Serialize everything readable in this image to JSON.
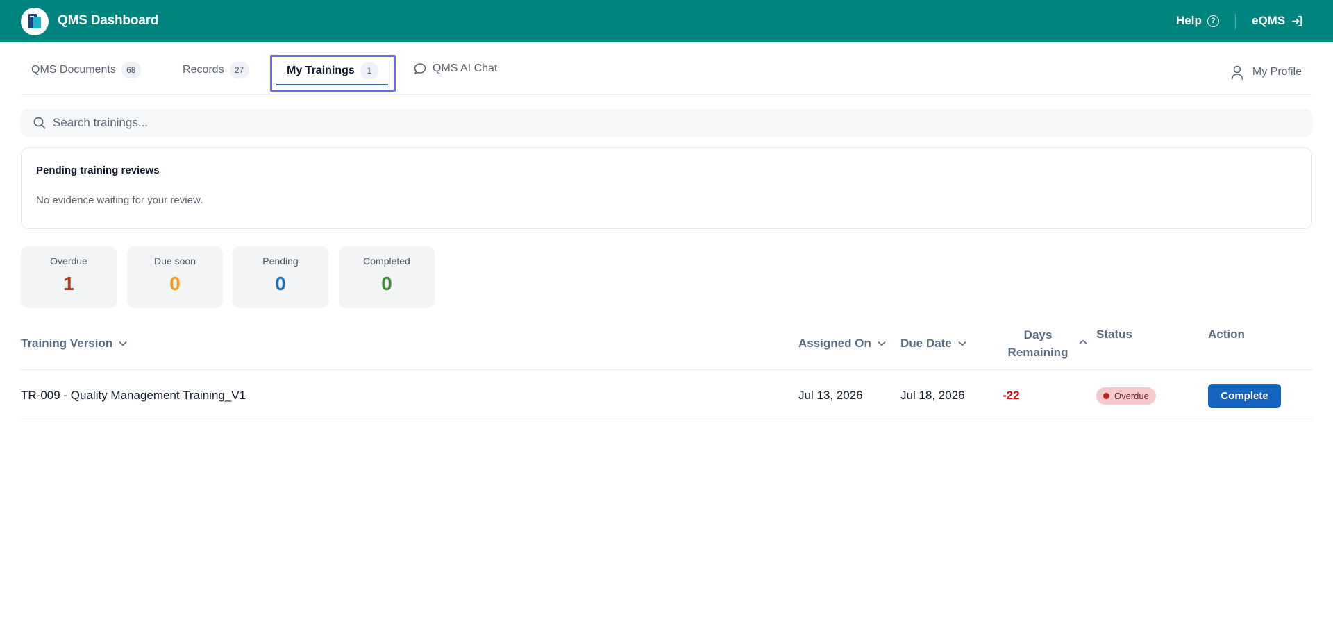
{
  "header": {
    "title": "QMS Dashboard",
    "help_label": "Help",
    "eqms_label": "eQMS",
    "colors": {
      "bar": "#00847f"
    }
  },
  "tabs": [
    {
      "label": "QMS Documents",
      "count": "68"
    },
    {
      "label": "Records",
      "count": "27"
    },
    {
      "label": "My Trainings",
      "count": "1",
      "active": true
    },
    {
      "label": "QMS AI Chat"
    }
  ],
  "profile": {
    "label": "My Profile"
  },
  "search": {
    "placeholder": "Search trainings..."
  },
  "pending": {
    "title": "Pending training reviews",
    "message": "No evidence waiting for your review."
  },
  "stats": [
    {
      "label": "Overdue",
      "value": "1",
      "color": "#a63a1a"
    },
    {
      "label": "Due soon",
      "value": "0",
      "color": "#f59b1a"
    },
    {
      "label": "Pending",
      "value": "0",
      "color": "#1d6fb8"
    },
    {
      "label": "Completed",
      "value": "0",
      "color": "#3d8b37"
    }
  ],
  "table": {
    "columns": {
      "version": "Training Version",
      "assigned": "Assigned On",
      "due": "Due Date",
      "days_line1": "Days",
      "days_line2": "Remaining",
      "status": "Status",
      "action": "Action"
    },
    "rows": [
      {
        "version": "TR-009 - Quality Management Training_V1",
        "assigned": "Jul 13, 2026",
        "due": "Jul 18, 2026",
        "days": "-22",
        "status": "Overdue",
        "action": "Complete"
      }
    ]
  }
}
